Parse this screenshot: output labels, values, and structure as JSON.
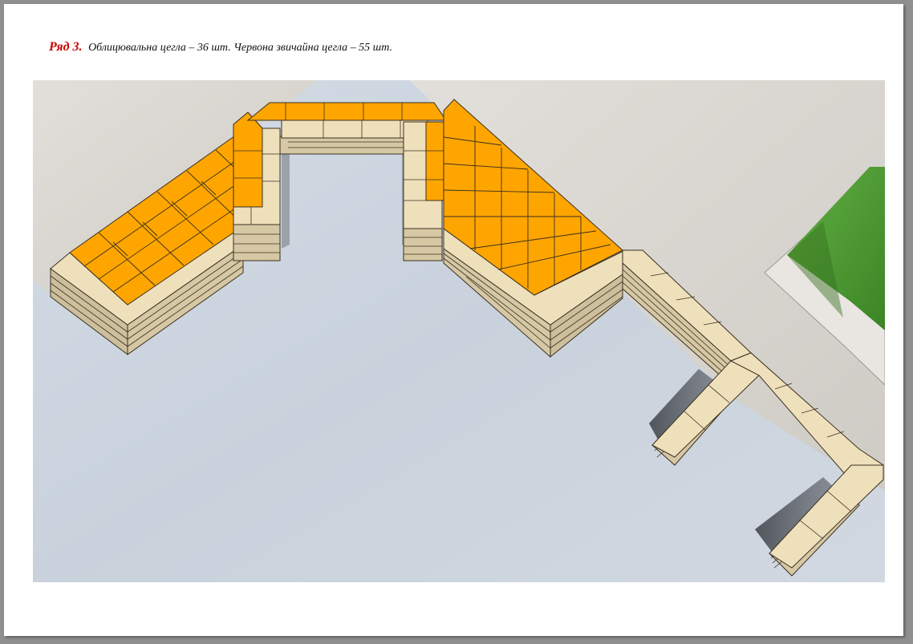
{
  "caption": {
    "row_label": "Ряд 3.",
    "text": "Облицювальна цегла – 36 шт. Червона звичайна цегла – 55 шт."
  },
  "colors": {
    "brick_red": "#ffa500",
    "brick_facing": "#efe0bc",
    "ground": "#cfd7e1",
    "paving": "#d8d5d0",
    "grass": "#4f9a33",
    "label_red": "#cc0000"
  }
}
